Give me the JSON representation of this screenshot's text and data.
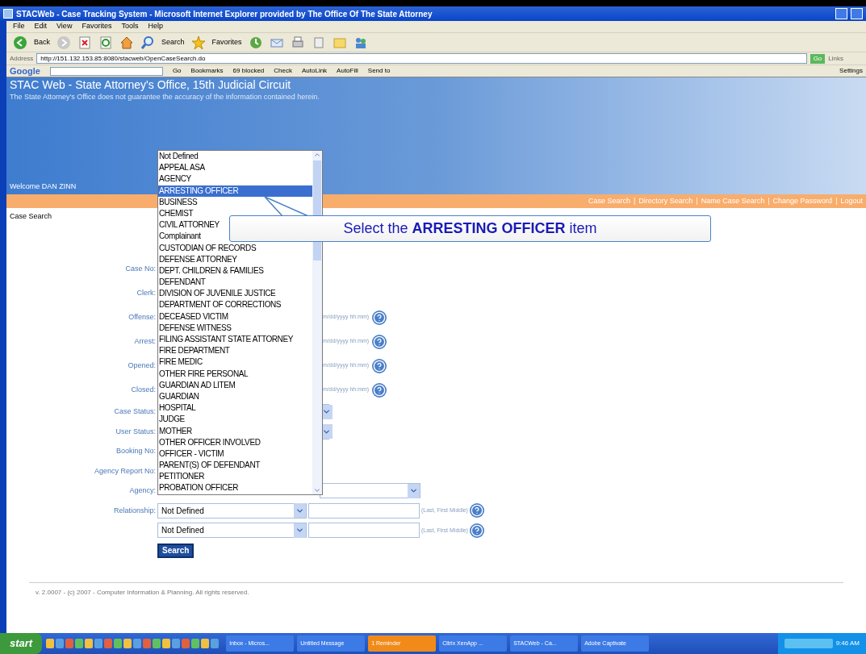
{
  "window": {
    "title": "STACWeb - Case Tracking System - Microsoft Internet Explorer provided by The Office Of The State Attorney",
    "menu": [
      "File",
      "Edit",
      "View",
      "Favorites",
      "Tools",
      "Help"
    ],
    "toolbar": {
      "back": "Back",
      "search": "Search",
      "favorites": "Favorites"
    },
    "address": {
      "label": "Address",
      "value": "http://151.132.153.85:8080/stacweb/OpenCaseSearch.do",
      "go": "Go",
      "links": "Links"
    },
    "google_bar": {
      "logo": "Google",
      "items": [
        "Go",
        "Bookmarks",
        "69 blocked",
        "Check",
        "AutoLink",
        "AutoFill",
        "Send to"
      ],
      "settings": "Settings"
    }
  },
  "page": {
    "title": "STAC Web - State Attorney's Office, 15th Judicial Circuit",
    "disclaimer": "The State Attorney's Office does not guarantee the accuracy of the information contained herein.",
    "welcome": "Welcome DAN ZINN",
    "nav": {
      "separator": "|",
      "links": [
        "Case Search",
        "Directory Search",
        "Name Case Search",
        "Change Password",
        "Logout"
      ]
    },
    "section": "Case Search",
    "form": [
      {
        "label": "Case No:",
        "kind": "text"
      },
      {
        "label": "Clerk:",
        "kind": "text"
      },
      {
        "label": "Offense:",
        "kind": "date",
        "hint": "m/dd/yyyy hh:mm)"
      },
      {
        "label": "Arrest:",
        "kind": "date",
        "hint": "m/dd/yyyy hh:mm)"
      },
      {
        "label": "Opened:",
        "kind": "date",
        "hint": "m/dd/yyyy hh:mm)"
      },
      {
        "label": "Closed:",
        "kind": "date",
        "hint": "m/dd/yyyy hh:mm)"
      },
      {
        "label": "Case Status:",
        "kind": "select"
      },
      {
        "label": "User Status:",
        "kind": "select"
      },
      {
        "label": "Booking No:",
        "kind": "text"
      },
      {
        "label": "Agency Report No:",
        "kind": "text"
      },
      {
        "label": "Agency:",
        "kind": "wide_select"
      },
      {
        "label": "Relationship:",
        "kind": "relationship",
        "value": "Not Defined",
        "hint": "(Last, First Middle)"
      },
      {
        "kind": "relationship",
        "value": "Not Defined",
        "hint": "(Last, First Middle)"
      }
    ],
    "search_button": "Search",
    "footer": "v. 2.0007 - (c) 2007 - Computer Information & Planning. All rights reserved."
  },
  "dropdown": {
    "options": [
      {
        "label": "Not Defined",
        "selected": false
      },
      {
        "label": "APPEAL ASA",
        "selected": false
      },
      {
        "label": "AGENCY",
        "selected": false
      },
      {
        "label": "ARRESTING OFFICER",
        "selected": true
      },
      {
        "label": "BUSINESS",
        "selected": false
      },
      {
        "label": "CHEMIST",
        "selected": false
      },
      {
        "label": "CIVIL ATTORNEY",
        "selected": false
      },
      {
        "label": "Complainant",
        "selected": false
      },
      {
        "label": "CUSTODIAN OF RECORDS",
        "selected": false
      },
      {
        "label": "DEFENSE ATTORNEY",
        "selected": false
      },
      {
        "label": "DEPT. CHILDREN & FAMILIES",
        "selected": false
      },
      {
        "label": "DEFENDANT",
        "selected": false
      },
      {
        "label": "DIVISION OF JUVENILE JUSTICE",
        "selected": false
      },
      {
        "label": "DEPARTMENT OF CORRECTIONS",
        "selected": false
      },
      {
        "label": "DECEASED VICTIM",
        "selected": false
      },
      {
        "label": "DEFENSE WITNESS",
        "selected": false
      },
      {
        "label": "FILING ASSISTANT STATE ATTORNEY",
        "selected": false
      },
      {
        "label": "FIRE DEPARTMENT",
        "selected": false
      },
      {
        "label": "FIRE MEDIC",
        "selected": false
      },
      {
        "label": "OTHER FIRE PERSONAL",
        "selected": false
      },
      {
        "label": "GUARDIAN AD LITEM",
        "selected": false
      },
      {
        "label": "GUARDIAN",
        "selected": false
      },
      {
        "label": "HOSPITAL",
        "selected": false
      },
      {
        "label": "JUDGE",
        "selected": false
      },
      {
        "label": "MOTHER",
        "selected": false
      },
      {
        "label": "OTHER OFFICER INVOLVED",
        "selected": false
      },
      {
        "label": "OFFICER - VICTIM",
        "selected": false
      },
      {
        "label": "PARENT(S) OF DEFENDANT",
        "selected": false
      },
      {
        "label": "PETITIONER",
        "selected": false
      },
      {
        "label": "PROBATION OFFICER",
        "selected": false
      }
    ]
  },
  "callout": {
    "text": "Select the **ARRESTING OFFICER** item"
  },
  "taskbar": {
    "start": "start",
    "tasks": [
      {
        "label": "Inbox - Micros...",
        "kind": "task"
      },
      {
        "label": "Untitled Message",
        "kind": "task"
      },
      {
        "label": "1 Reminder",
        "kind": "alert"
      },
      {
        "label": "Citrix XenApp ...",
        "kind": "task"
      },
      {
        "label": "STACWeb - Ca...",
        "kind": "task"
      },
      {
        "label": "Adobe Captivate",
        "kind": "task"
      }
    ],
    "clock": "9:46 AM"
  }
}
